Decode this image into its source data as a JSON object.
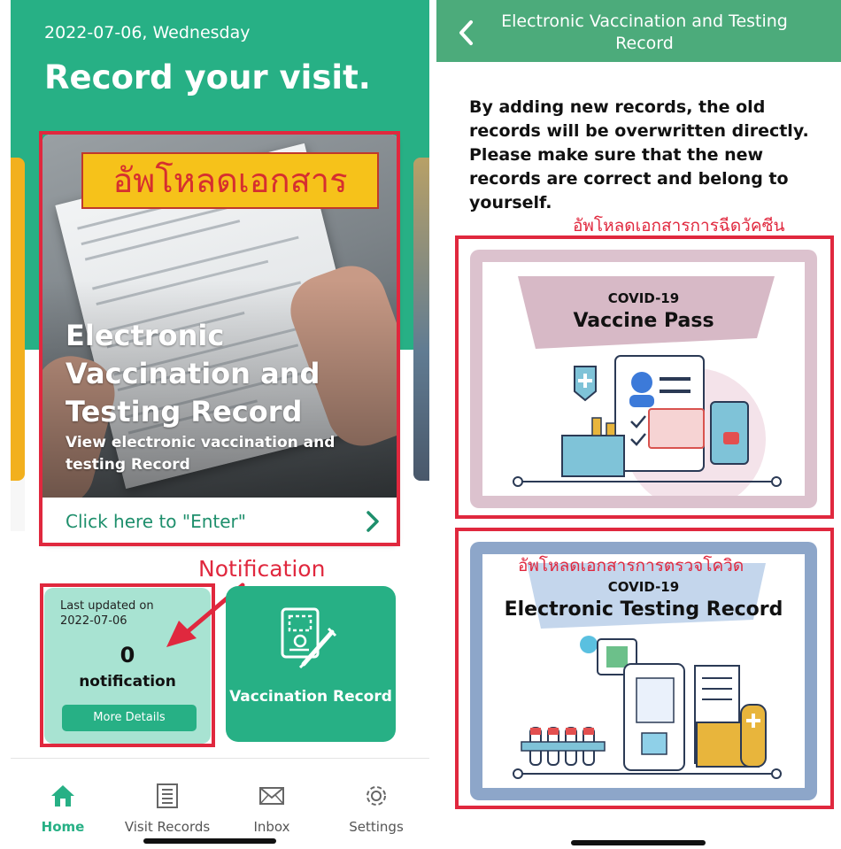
{
  "left": {
    "date": "2022-07-06, Wednesday",
    "headline": "Record your visit.",
    "card": {
      "title": "Electronic Vaccination and Testing Record",
      "subtitle": "View electronic vaccination and testing Record",
      "enter": "Click here to \"Enter\"",
      "overlay_thai": "อัพโหลดเอกสาร"
    },
    "notification_callout": "Notification",
    "notification_card": {
      "updated_label": "Last updated on",
      "updated_date": "2022-07-06",
      "count": "0",
      "word": "notification",
      "button": "More Details"
    },
    "vaccination_card": {
      "label": "Vaccination Record"
    },
    "tabs": [
      {
        "label": "Home",
        "icon": "home-icon",
        "active": true
      },
      {
        "label": "Visit Records",
        "icon": "list-icon",
        "active": false
      },
      {
        "label": "Inbox",
        "icon": "mail-icon",
        "active": false
      },
      {
        "label": "Settings",
        "icon": "gear-icon",
        "active": false
      }
    ],
    "colors": {
      "brand": "#27b085",
      "annotation": "#e0283e"
    }
  },
  "right": {
    "header_title": "Electronic Vaccination and Testing Record",
    "warning": "By adding new records, the old records will be overwritten directly. Please make sure that the new records are correct and belong to yourself.",
    "thai_vaccine": "อัพโหลดเอกสารการฉีดวัคซีน",
    "vaccine_pass": {
      "top": "COVID-19",
      "main": "Vaccine Pass"
    },
    "thai_testing": "อัพโหลดเอกสารการตรวจโควิด",
    "testing_record": {
      "top": "COVID-19",
      "main": "Electronic Testing Record"
    }
  }
}
